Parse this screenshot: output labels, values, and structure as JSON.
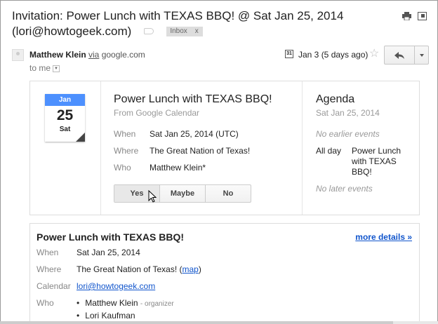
{
  "email": {
    "subject": "Invitation: Power Lunch with TEXAS BBQ! @ Sat Jan 25, 2014 (lori@howtogeek.com)",
    "label_chip": "Inbox",
    "label_chip_close": "x"
  },
  "sender": {
    "name": "Matthew Klein",
    "via_word": "via",
    "via_domain": "google.com",
    "to_text": "to me",
    "date": "Jan 3 (5 days ago)",
    "cal_icon_text": "31"
  },
  "invite": {
    "cal_month": "Jan",
    "cal_day": "25",
    "cal_dow": "Sat",
    "title": "Power Lunch with TEXAS BBQ!",
    "from": "From Google Calendar",
    "when_label": "When",
    "when_value": "Sat Jan 25, 2014 (UTC)",
    "where_label": "Where",
    "where_value": "The Great Nation of Texas!",
    "who_label": "Who",
    "who_value": "Matthew Klein*",
    "rsvp": {
      "yes": "Yes",
      "maybe": "Maybe",
      "no": "No"
    },
    "agenda": {
      "title": "Agenda",
      "date": "Sat Jan 25, 2014",
      "no_earlier": "No earlier events",
      "all_day": "All day",
      "event": "Power Lunch with TEXAS BBQ!",
      "no_later": "No later events"
    }
  },
  "details": {
    "title": "Power Lunch with TEXAS BBQ!",
    "more_link": "more details »",
    "when_label": "When",
    "when_value": "Sat Jan 25, 2014",
    "where_label": "Where",
    "where_value": "The Great Nation of Texas! (",
    "where_map": "map",
    "where_close": ")",
    "calendar_label": "Calendar",
    "calendar_value": "lori@howtogeek.com",
    "who_label": "Who",
    "attendees": [
      {
        "name": "Matthew Klein",
        "role": "- organizer"
      },
      {
        "name": "Lori Kaufman",
        "role": ""
      }
    ]
  }
}
